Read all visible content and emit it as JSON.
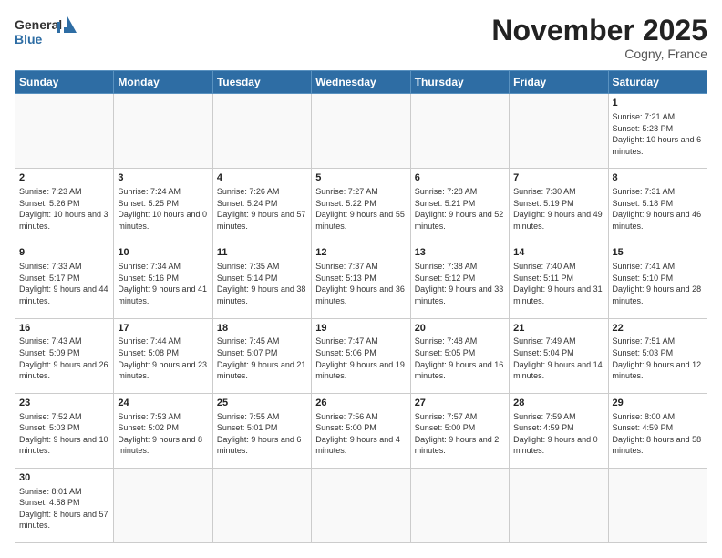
{
  "header": {
    "logo_general": "General",
    "logo_blue": "Blue",
    "title": "November 2025",
    "location": "Cogny, France"
  },
  "days_of_week": [
    "Sunday",
    "Monday",
    "Tuesday",
    "Wednesday",
    "Thursday",
    "Friday",
    "Saturday"
  ],
  "weeks": [
    [
      {
        "day": "",
        "info": ""
      },
      {
        "day": "",
        "info": ""
      },
      {
        "day": "",
        "info": ""
      },
      {
        "day": "",
        "info": ""
      },
      {
        "day": "",
        "info": ""
      },
      {
        "day": "",
        "info": ""
      },
      {
        "day": "1",
        "info": "Sunrise: 7:21 AM\nSunset: 5:28 PM\nDaylight: 10 hours and 6 minutes."
      }
    ],
    [
      {
        "day": "2",
        "info": "Sunrise: 7:23 AM\nSunset: 5:26 PM\nDaylight: 10 hours and 3 minutes."
      },
      {
        "day": "3",
        "info": "Sunrise: 7:24 AM\nSunset: 5:25 PM\nDaylight: 10 hours and 0 minutes."
      },
      {
        "day": "4",
        "info": "Sunrise: 7:26 AM\nSunset: 5:24 PM\nDaylight: 9 hours and 57 minutes."
      },
      {
        "day": "5",
        "info": "Sunrise: 7:27 AM\nSunset: 5:22 PM\nDaylight: 9 hours and 55 minutes."
      },
      {
        "day": "6",
        "info": "Sunrise: 7:28 AM\nSunset: 5:21 PM\nDaylight: 9 hours and 52 minutes."
      },
      {
        "day": "7",
        "info": "Sunrise: 7:30 AM\nSunset: 5:19 PM\nDaylight: 9 hours and 49 minutes."
      },
      {
        "day": "8",
        "info": "Sunrise: 7:31 AM\nSunset: 5:18 PM\nDaylight: 9 hours and 46 minutes."
      }
    ],
    [
      {
        "day": "9",
        "info": "Sunrise: 7:33 AM\nSunset: 5:17 PM\nDaylight: 9 hours and 44 minutes."
      },
      {
        "day": "10",
        "info": "Sunrise: 7:34 AM\nSunset: 5:16 PM\nDaylight: 9 hours and 41 minutes."
      },
      {
        "day": "11",
        "info": "Sunrise: 7:35 AM\nSunset: 5:14 PM\nDaylight: 9 hours and 38 minutes."
      },
      {
        "day": "12",
        "info": "Sunrise: 7:37 AM\nSunset: 5:13 PM\nDaylight: 9 hours and 36 minutes."
      },
      {
        "day": "13",
        "info": "Sunrise: 7:38 AM\nSunset: 5:12 PM\nDaylight: 9 hours and 33 minutes."
      },
      {
        "day": "14",
        "info": "Sunrise: 7:40 AM\nSunset: 5:11 PM\nDaylight: 9 hours and 31 minutes."
      },
      {
        "day": "15",
        "info": "Sunrise: 7:41 AM\nSunset: 5:10 PM\nDaylight: 9 hours and 28 minutes."
      }
    ],
    [
      {
        "day": "16",
        "info": "Sunrise: 7:43 AM\nSunset: 5:09 PM\nDaylight: 9 hours and 26 minutes."
      },
      {
        "day": "17",
        "info": "Sunrise: 7:44 AM\nSunset: 5:08 PM\nDaylight: 9 hours and 23 minutes."
      },
      {
        "day": "18",
        "info": "Sunrise: 7:45 AM\nSunset: 5:07 PM\nDaylight: 9 hours and 21 minutes."
      },
      {
        "day": "19",
        "info": "Sunrise: 7:47 AM\nSunset: 5:06 PM\nDaylight: 9 hours and 19 minutes."
      },
      {
        "day": "20",
        "info": "Sunrise: 7:48 AM\nSunset: 5:05 PM\nDaylight: 9 hours and 16 minutes."
      },
      {
        "day": "21",
        "info": "Sunrise: 7:49 AM\nSunset: 5:04 PM\nDaylight: 9 hours and 14 minutes."
      },
      {
        "day": "22",
        "info": "Sunrise: 7:51 AM\nSunset: 5:03 PM\nDaylight: 9 hours and 12 minutes."
      }
    ],
    [
      {
        "day": "23",
        "info": "Sunrise: 7:52 AM\nSunset: 5:03 PM\nDaylight: 9 hours and 10 minutes."
      },
      {
        "day": "24",
        "info": "Sunrise: 7:53 AM\nSunset: 5:02 PM\nDaylight: 9 hours and 8 minutes."
      },
      {
        "day": "25",
        "info": "Sunrise: 7:55 AM\nSunset: 5:01 PM\nDaylight: 9 hours and 6 minutes."
      },
      {
        "day": "26",
        "info": "Sunrise: 7:56 AM\nSunset: 5:00 PM\nDaylight: 9 hours and 4 minutes."
      },
      {
        "day": "27",
        "info": "Sunrise: 7:57 AM\nSunset: 5:00 PM\nDaylight: 9 hours and 2 minutes."
      },
      {
        "day": "28",
        "info": "Sunrise: 7:59 AM\nSunset: 4:59 PM\nDaylight: 9 hours and 0 minutes."
      },
      {
        "day": "29",
        "info": "Sunrise: 8:00 AM\nSunset: 4:59 PM\nDaylight: 8 hours and 58 minutes."
      }
    ],
    [
      {
        "day": "30",
        "info": "Sunrise: 8:01 AM\nSunset: 4:58 PM\nDaylight: 8 hours and 57 minutes."
      },
      {
        "day": "",
        "info": ""
      },
      {
        "day": "",
        "info": ""
      },
      {
        "day": "",
        "info": ""
      },
      {
        "day": "",
        "info": ""
      },
      {
        "day": "",
        "info": ""
      },
      {
        "day": "",
        "info": ""
      }
    ]
  ]
}
